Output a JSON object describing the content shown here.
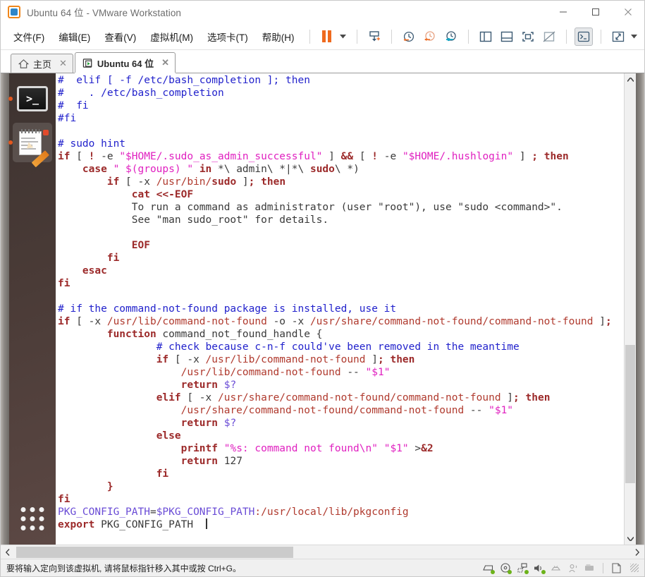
{
  "window": {
    "title": "Ubuntu 64 位 - VMware Workstation",
    "logo_icon": "vmware-logo-icon",
    "minimize_label": "—",
    "maximize_label": "□",
    "close_label": "✕"
  },
  "menubar": {
    "items": [
      {
        "label": "文件(F)",
        "name": "menu-file"
      },
      {
        "label": "编辑(E)",
        "name": "menu-edit"
      },
      {
        "label": "查看(V)",
        "name": "menu-view"
      },
      {
        "label": "虚拟机(M)",
        "name": "menu-vm"
      },
      {
        "label": "选项卡(T)",
        "name": "menu-tabs"
      },
      {
        "label": "帮助(H)",
        "name": "menu-help"
      }
    ],
    "toolbar": [
      {
        "name": "pause-vm-button",
        "icon": "pause-icon"
      },
      {
        "name": "power-dropdown-button",
        "icon": "chevron-down-icon"
      },
      {
        "name": "snapshot-take-button",
        "icon": "snapshot-add-icon"
      },
      {
        "name": "snapshot-revert-button",
        "icon": "snapshot-revert-icon"
      },
      {
        "name": "snapshot-manager-button",
        "icon": "snapshot-manager-icon"
      },
      {
        "name": "show-sidebar-button",
        "icon": "panel-left-icon"
      },
      {
        "name": "show-bottom-panel-button",
        "icon": "panel-bottom-icon"
      },
      {
        "name": "fullscreen-button",
        "icon": "fullscreen-icon"
      },
      {
        "name": "unity-mode-button",
        "icon": "unity-mode-icon"
      },
      {
        "name": "console-view-button",
        "icon": "terminal-icon"
      },
      {
        "name": "stretch-view-button",
        "icon": "stretch-icon"
      },
      {
        "name": "stretch-dropdown-button",
        "icon": "chevron-down-icon"
      }
    ]
  },
  "tabs": [
    {
      "label": "主页",
      "icon": "home-icon",
      "close": "✕",
      "selected": false
    },
    {
      "label": "Ubuntu 64 位",
      "icon": "vm-play-icon",
      "close": "✕",
      "selected": true
    }
  ],
  "launcher": {
    "items": [
      {
        "name": "launcher-item-terminal",
        "icon": "terminal-icon",
        "running": true,
        "selected": false
      },
      {
        "name": "launcher-item-text-editor",
        "icon": "notepad-pencil-icon",
        "running": true,
        "selected": true
      }
    ],
    "apps_grid_icon": "apps-grid-icon"
  },
  "terminal": {
    "lines": [
      [
        {
          "t": "#  elif [ -f /etc/bash_completion ]; then",
          "c": "c-cmt"
        }
      ],
      [
        {
          "t": "#    . /etc/bash_completion",
          "c": "c-cmt"
        }
      ],
      [
        {
          "t": "#  fi",
          "c": "c-cmt"
        }
      ],
      [
        {
          "t": "#fi",
          "c": "c-cmt"
        }
      ],
      [
        {
          "t": "",
          "c": "c-txt"
        }
      ],
      [
        {
          "t": "# sudo hint",
          "c": "c-cmt"
        }
      ],
      [
        {
          "t": "if",
          "c": "c-kw"
        },
        {
          "t": " [ ",
          "c": "c-txt"
        },
        {
          "t": "!",
          "c": "c-kw"
        },
        {
          "t": " -e ",
          "c": "c-txt"
        },
        {
          "t": "\"$HOME/.sudo_as_admin_successful\"",
          "c": "c-str"
        },
        {
          "t": " ] ",
          "c": "c-txt"
        },
        {
          "t": "&&",
          "c": "c-kw"
        },
        {
          "t": " [ ",
          "c": "c-txt"
        },
        {
          "t": "!",
          "c": "c-kw"
        },
        {
          "t": " -e ",
          "c": "c-txt"
        },
        {
          "t": "\"$HOME/.hushlogin\"",
          "c": "c-str"
        },
        {
          "t": " ] ",
          "c": "c-txt"
        },
        {
          "t": ";",
          "c": "c-kw"
        },
        {
          "t": " ",
          "c": "c-txt"
        },
        {
          "t": "then",
          "c": "c-kw"
        }
      ],
      [
        {
          "t": "    ",
          "c": "c-txt"
        },
        {
          "t": "case",
          "c": "c-kw"
        },
        {
          "t": " ",
          "c": "c-txt"
        },
        {
          "t": "\" $(groups) \"",
          "c": "c-str"
        },
        {
          "t": " ",
          "c": "c-txt"
        },
        {
          "t": "in",
          "c": "c-kw"
        },
        {
          "t": " *\\ admin\\ *|*\\ ",
          "c": "c-txt"
        },
        {
          "t": "sudo",
          "c": "c-kw"
        },
        {
          "t": "\\ *)",
          "c": "c-txt"
        }
      ],
      [
        {
          "t": "        ",
          "c": "c-txt"
        },
        {
          "t": "if",
          "c": "c-kw"
        },
        {
          "t": " [ -x ",
          "c": "c-txt"
        },
        {
          "t": "/usr/bin/",
          "c": "c-path"
        },
        {
          "t": "sudo",
          "c": "c-kw"
        },
        {
          "t": " ]",
          "c": "c-txt"
        },
        {
          "t": ";",
          "c": "c-kw"
        },
        {
          "t": " ",
          "c": "c-txt"
        },
        {
          "t": "then",
          "c": "c-kw"
        }
      ],
      [
        {
          "t": "            ",
          "c": "c-txt"
        },
        {
          "t": "cat <<-EOF",
          "c": "c-kw"
        }
      ],
      [
        {
          "t": "            To run a command as administrator (user \"root\"), use \"sudo <command>\".",
          "c": "c-txt"
        }
      ],
      [
        {
          "t": "            See \"man sudo_root\" for details.",
          "c": "c-txt"
        }
      ],
      [
        {
          "t": "",
          "c": "c-txt"
        }
      ],
      [
        {
          "t": "            ",
          "c": "c-txt"
        },
        {
          "t": "EOF",
          "c": "c-kw"
        }
      ],
      [
        {
          "t": "        ",
          "c": "c-txt"
        },
        {
          "t": "fi",
          "c": "c-kw"
        }
      ],
      [
        {
          "t": "    ",
          "c": "c-txt"
        },
        {
          "t": "esac",
          "c": "c-kw"
        }
      ],
      [
        {
          "t": "fi",
          "c": "c-kw"
        }
      ],
      [
        {
          "t": "",
          "c": "c-txt"
        }
      ],
      [
        {
          "t": "# if the command-not-found package is installed, use it",
          "c": "c-cmt"
        }
      ],
      [
        {
          "t": "if",
          "c": "c-kw"
        },
        {
          "t": " [ -x ",
          "c": "c-txt"
        },
        {
          "t": "/usr/lib/command-not-found",
          "c": "c-path"
        },
        {
          "t": " -o -x ",
          "c": "c-txt"
        },
        {
          "t": "/usr/share/command-not-found/command-not-found",
          "c": "c-path"
        },
        {
          "t": " ]",
          "c": "c-txt"
        },
        {
          "t": ";",
          "c": "c-kw"
        }
      ],
      [
        {
          "t": "        ",
          "c": "c-txt"
        },
        {
          "t": "function",
          "c": "c-kw"
        },
        {
          "t": " command_not_found_handle {",
          "c": "c-txt"
        }
      ],
      [
        {
          "t": "                ",
          "c": "c-txt"
        },
        {
          "t": "# check because c-n-f could've been removed in the meantime",
          "c": "c-cmt"
        }
      ],
      [
        {
          "t": "                ",
          "c": "c-txt"
        },
        {
          "t": "if",
          "c": "c-kw"
        },
        {
          "t": " [ -x ",
          "c": "c-txt"
        },
        {
          "t": "/usr/lib/command-not-found",
          "c": "c-path"
        },
        {
          "t": " ]",
          "c": "c-txt"
        },
        {
          "t": ";",
          "c": "c-kw"
        },
        {
          "t": " ",
          "c": "c-txt"
        },
        {
          "t": "then",
          "c": "c-kw"
        }
      ],
      [
        {
          "t": "                    ",
          "c": "c-txt"
        },
        {
          "t": "/usr/lib/command-not-found",
          "c": "c-path"
        },
        {
          "t": " -- ",
          "c": "c-txt"
        },
        {
          "t": "\"$1\"",
          "c": "c-str"
        }
      ],
      [
        {
          "t": "                    ",
          "c": "c-txt"
        },
        {
          "t": "return",
          "c": "c-kw"
        },
        {
          "t": " ",
          "c": "c-txt"
        },
        {
          "t": "$?",
          "c": "c-var"
        }
      ],
      [
        {
          "t": "                ",
          "c": "c-txt"
        },
        {
          "t": "elif",
          "c": "c-kw"
        },
        {
          "t": " [ -x ",
          "c": "c-txt"
        },
        {
          "t": "/usr/share/command-not-found/command-not-found",
          "c": "c-path"
        },
        {
          "t": " ]",
          "c": "c-txt"
        },
        {
          "t": ";",
          "c": "c-kw"
        },
        {
          "t": " ",
          "c": "c-txt"
        },
        {
          "t": "then",
          "c": "c-kw"
        }
      ],
      [
        {
          "t": "                    ",
          "c": "c-txt"
        },
        {
          "t": "/usr/share/command-not-found/command-not-found",
          "c": "c-path"
        },
        {
          "t": " -- ",
          "c": "c-txt"
        },
        {
          "t": "\"$1\"",
          "c": "c-str"
        }
      ],
      [
        {
          "t": "                    ",
          "c": "c-txt"
        },
        {
          "t": "return",
          "c": "c-kw"
        },
        {
          "t": " ",
          "c": "c-txt"
        },
        {
          "t": "$?",
          "c": "c-var"
        }
      ],
      [
        {
          "t": "                ",
          "c": "c-txt"
        },
        {
          "t": "else",
          "c": "c-kw"
        }
      ],
      [
        {
          "t": "                    ",
          "c": "c-txt"
        },
        {
          "t": "printf",
          "c": "c-kw"
        },
        {
          "t": " ",
          "c": "c-txt"
        },
        {
          "t": "\"%s: command not found\\n\"",
          "c": "c-str"
        },
        {
          "t": " ",
          "c": "c-txt"
        },
        {
          "t": "\"$1\"",
          "c": "c-str"
        },
        {
          "t": " >",
          "c": "c-txt"
        },
        {
          "t": "&2",
          "c": "c-kw"
        }
      ],
      [
        {
          "t": "                    ",
          "c": "c-txt"
        },
        {
          "t": "return",
          "c": "c-kw"
        },
        {
          "t": " ",
          "c": "c-txt"
        },
        {
          "t": "127",
          "c": "c-num"
        }
      ],
      [
        {
          "t": "                ",
          "c": "c-txt"
        },
        {
          "t": "fi",
          "c": "c-kw"
        }
      ],
      [
        {
          "t": "        ",
          "c": "c-txt"
        },
        {
          "t": "}",
          "c": "c-kw"
        }
      ],
      [
        {
          "t": "fi",
          "c": "c-kw"
        }
      ],
      [
        {
          "t": "PKG_CONFIG_PATH",
          "c": "c-var"
        },
        {
          "t": "=",
          "c": "c-txt"
        },
        {
          "t": "$PKG_CONFIG_PATH",
          "c": "c-var"
        },
        {
          "t": ":",
          "c": "c-path"
        },
        {
          "t": "/usr/local/lib/pkgconfig",
          "c": "c-path"
        }
      ],
      [
        {
          "t": "export",
          "c": "c-kw"
        },
        {
          "t": " PKG_CONFIG_PATH  ",
          "c": "c-txt"
        },
        {
          "t": "|CURSOR|",
          "c": "c-txt"
        }
      ]
    ]
  },
  "scrollbars": {
    "vertical_up_icon": "chevron-up-icon",
    "vertical_down_icon": "chevron-down-icon",
    "horizontal_left_icon": "chevron-left-icon",
    "horizontal_right_icon": "chevron-right-icon"
  },
  "statusbar": {
    "message": "要将输入定向到该虚拟机, 请将鼠标指针移入其中或按 Ctrl+G。",
    "icons": [
      {
        "name": "status-harddisk-icon",
        "icon": "harddisk-icon",
        "active": true
      },
      {
        "name": "status-cdrom-icon",
        "icon": "cd-icon",
        "active": true
      },
      {
        "name": "status-network-icon",
        "icon": "network-icon",
        "active": true
      },
      {
        "name": "status-sound-icon",
        "icon": "speaker-icon",
        "active": true
      },
      {
        "name": "status-printer-icon",
        "icon": "printer-icon",
        "active": false
      },
      {
        "name": "status-usb-icon",
        "icon": "usb-device-icon",
        "active": false
      },
      {
        "name": "status-removable-icon",
        "icon": "removable-drive-icon",
        "active": false
      },
      {
        "name": "status-message-icon",
        "icon": "message-log-icon",
        "active": false
      }
    ]
  },
  "colors": {
    "accent_orange": "#ef6a1e",
    "comment_blue": "#2222cc",
    "keyword_red": "#9c2a2a",
    "string_magenta": "#e020c0",
    "path_red": "#b03a2e",
    "var_purple": "#6a4cd6",
    "launcher_bg": "#4a3b37",
    "status_green": "#6cb21a"
  }
}
